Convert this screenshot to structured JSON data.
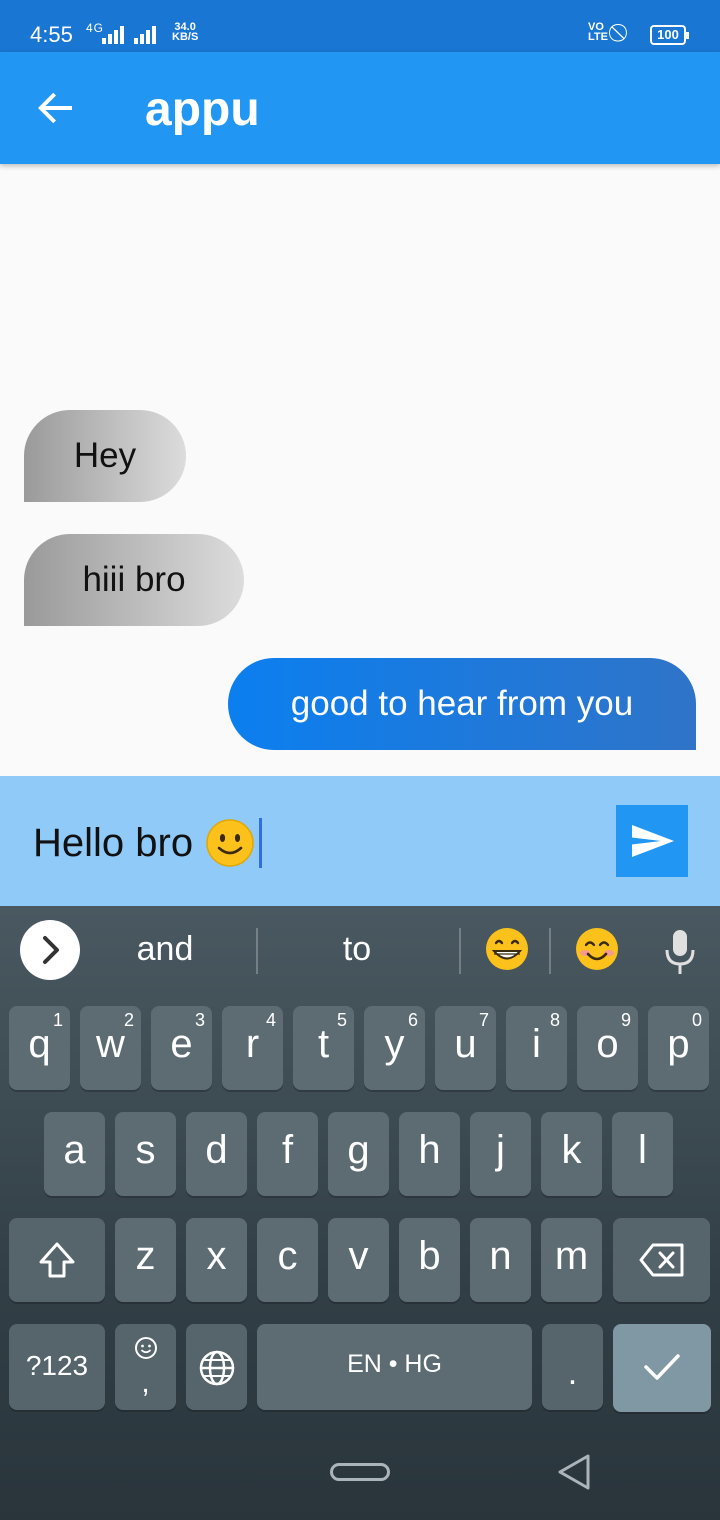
{
  "status_bar": {
    "time": "4:55",
    "network": "4G",
    "speed_value": "34.0",
    "speed_unit": "KB/S",
    "volte_top": "VO",
    "volte_bottom": "LTE",
    "battery": "100"
  },
  "app_bar": {
    "title": "appu",
    "back_icon": "arrow-back-icon"
  },
  "messages": [
    {
      "text": "Hey",
      "direction": "incoming"
    },
    {
      "text": "hiii bro",
      "direction": "incoming"
    },
    {
      "text": "good to hear from you",
      "direction": "outgoing"
    }
  ],
  "composer": {
    "value": "Hello bro",
    "emoji_icon": "slightly-smiling-face-icon",
    "send_icon": "send-icon"
  },
  "keyboard": {
    "suggestions": [
      "and",
      "to"
    ],
    "suggestion_emojis": [
      "grinning-face-icon",
      "smiling-face-icon"
    ],
    "row1": [
      "q",
      "w",
      "e",
      "r",
      "t",
      "y",
      "u",
      "i",
      "o",
      "p"
    ],
    "row1_hints": [
      "1",
      "2",
      "3",
      "4",
      "5",
      "6",
      "7",
      "8",
      "9",
      "0"
    ],
    "row2": [
      "a",
      "s",
      "d",
      "f",
      "g",
      "h",
      "j",
      "k",
      "l"
    ],
    "row3": [
      "z",
      "x",
      "c",
      "v",
      "b",
      "n",
      "m"
    ],
    "symbols_label": "?123",
    "comma": ",",
    "space_label": "EN • HG",
    "period": "."
  },
  "colors": {
    "status_bar": "#1976d2",
    "app_bar": "#2196f3",
    "composer": "#90caf9",
    "send_button": "#2196f3"
  }
}
